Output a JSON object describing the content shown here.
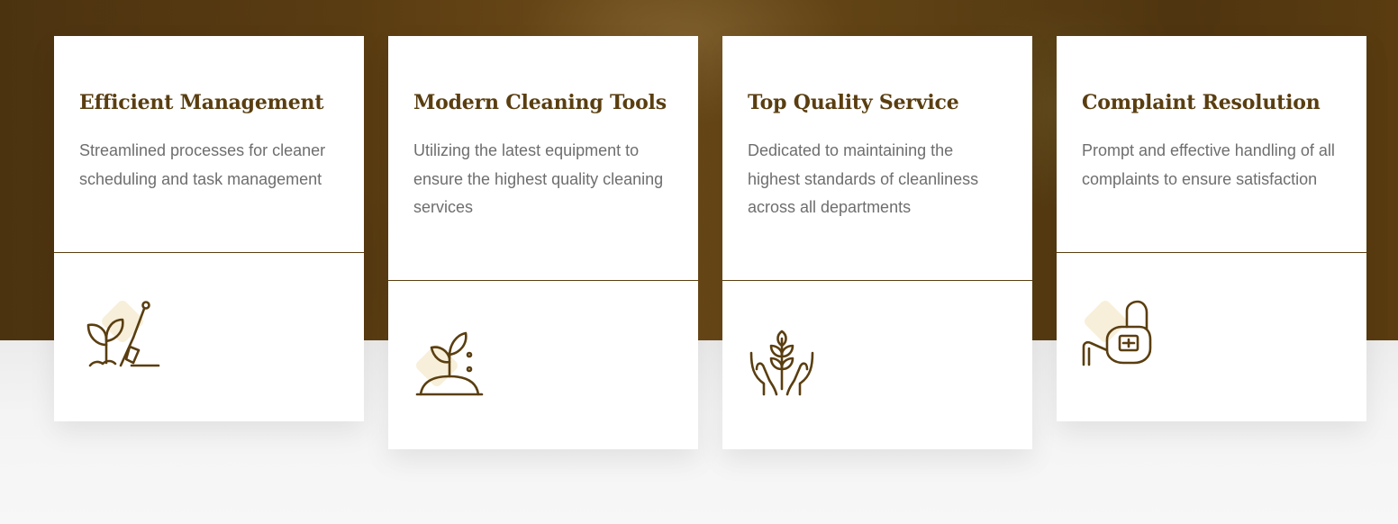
{
  "colors": {
    "accent": "#5a3e10",
    "body_text": "#6e6e6e",
    "icon_bg": "#f7efd9"
  },
  "cards": [
    {
      "title": "Efficient Management",
      "text": "Streamlined processes for cleaner scheduling and task management",
      "icon": "gardening-tools-icon"
    },
    {
      "title": "Modern Cleaning Tools",
      "text": "Utilizing the latest equipment to ensure the highest quality cleaning services",
      "icon": "sprout-icon"
    },
    {
      "title": "Top Quality Service",
      "text": "Dedicated to maintaining the highest standards of cleanliness across all departments",
      "icon": "hands-plant-icon"
    },
    {
      "title": "Complaint Resolution",
      "text": "Prompt and effective handling of all complaints to ensure satisfaction",
      "icon": "watering-can-icon"
    }
  ]
}
